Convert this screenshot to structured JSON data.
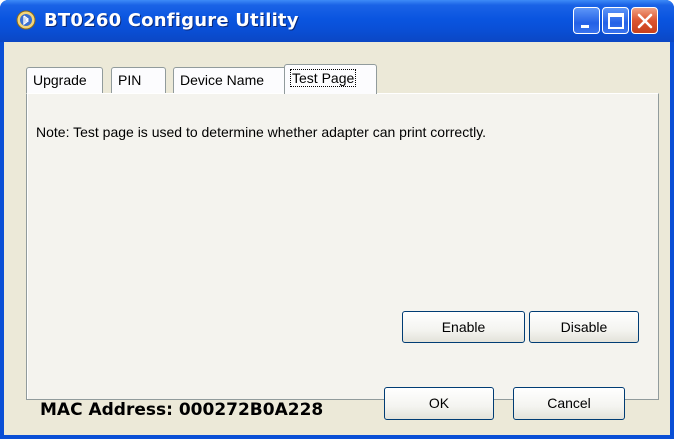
{
  "window": {
    "title": "BT0260 Configure Utility",
    "icon": "bluetooth-app-icon"
  },
  "title_buttons": {
    "minimize_icon": "minimize-icon",
    "maximize_icon": "maximize-icon",
    "close_icon": "close-icon"
  },
  "tabs": [
    {
      "label": "Upgrade",
      "selected": false
    },
    {
      "label": "PIN",
      "selected": false
    },
    {
      "label": "Device Name",
      "selected": false
    },
    {
      "label": "Test Page",
      "selected": true
    }
  ],
  "test_page": {
    "note": "Note: Test page is used to determine whether adapter can print correctly.",
    "enable_label": "Enable",
    "disable_label": "Disable"
  },
  "footer": {
    "mac_address": "MAC Address: 000272B0A228",
    "ok_label": "OK",
    "cancel_label": "Cancel"
  },
  "colors": {
    "titlebar": "#0a4fd6",
    "dialog_face": "#ece9d8",
    "close_button": "#dc5530"
  }
}
